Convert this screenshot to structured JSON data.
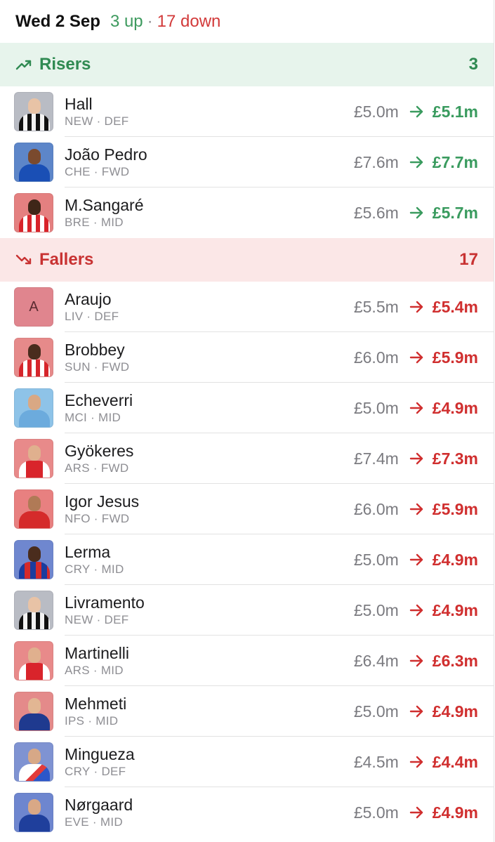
{
  "header": {
    "date": "Wed 2 Sep",
    "up_text": "3 up",
    "separator": "·",
    "down_text": "17 down"
  },
  "colors": {
    "rise": "#3a9b5f",
    "fall": "#d02f2f",
    "rise_bg": "#e7f4ec",
    "fall_bg": "#fbe7e7"
  },
  "risers": {
    "title": "Risers",
    "count": "3",
    "icon": "trending-up-icon",
    "players": [
      {
        "name": "Hall",
        "team": "NEW",
        "pos": "DEF",
        "old": "£5.0m",
        "new": "£5.1m",
        "kit": "newcastle"
      },
      {
        "name": "João Pedro",
        "team": "CHE",
        "pos": "FWD",
        "old": "£7.6m",
        "new": "£7.7m",
        "kit": "chelsea"
      },
      {
        "name": "M.Sangaré",
        "team": "BRE",
        "pos": "MID",
        "old": "£5.6m",
        "new": "£5.7m",
        "kit": "brentford"
      }
    ]
  },
  "fallers": {
    "title": "Fallers",
    "count": "17",
    "icon": "trending-down-icon",
    "players": [
      {
        "name": "Araujo",
        "team": "LIV",
        "pos": "DEF",
        "old": "£5.5m",
        "new": "£5.4m",
        "kit": "placeholder",
        "initial": "A"
      },
      {
        "name": "Brobbey",
        "team": "SUN",
        "pos": "FWD",
        "old": "£6.0m",
        "new": "£5.9m",
        "kit": "sunderland"
      },
      {
        "name": "Echeverri",
        "team": "MCI",
        "pos": "MID",
        "old": "£5.0m",
        "new": "£4.9m",
        "kit": "mancity"
      },
      {
        "name": "Gyökeres",
        "team": "ARS",
        "pos": "FWD",
        "old": "£7.4m",
        "new": "£7.3m",
        "kit": "arsenal"
      },
      {
        "name": "Igor Jesus",
        "team": "NFO",
        "pos": "FWD",
        "old": "£6.0m",
        "new": "£5.9m",
        "kit": "forest"
      },
      {
        "name": "Lerma",
        "team": "CRY",
        "pos": "MID",
        "old": "£5.0m",
        "new": "£4.9m",
        "kit": "palace"
      },
      {
        "name": "Livramento",
        "team": "NEW",
        "pos": "DEF",
        "old": "£5.0m",
        "new": "£4.9m",
        "kit": "newcastle"
      },
      {
        "name": "Martinelli",
        "team": "ARS",
        "pos": "MID",
        "old": "£6.4m",
        "new": "£6.3m",
        "kit": "arsenal"
      },
      {
        "name": "Mehmeti",
        "team": "IPS",
        "pos": "MID",
        "old": "£5.0m",
        "new": "£4.9m",
        "kit": "ipswich"
      },
      {
        "name": "Mingueza",
        "team": "CRY",
        "pos": "DEF",
        "old": "£4.5m",
        "new": "£4.4m",
        "kit": "palace-away"
      },
      {
        "name": "Nørgaard",
        "team": "EVE",
        "pos": "MID",
        "old": "£5.0m",
        "new": "£4.9m",
        "kit": "everton"
      }
    ]
  }
}
